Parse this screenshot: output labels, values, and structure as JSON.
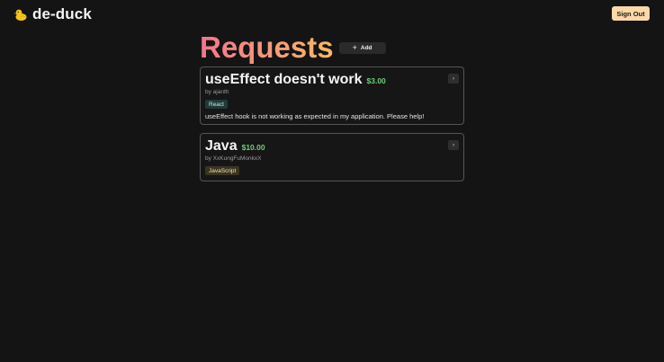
{
  "brand": {
    "name": "de-duck",
    "icon": "duck-icon"
  },
  "header": {
    "sign_out_label": "Sign Out"
  },
  "page": {
    "title": "Requests",
    "add_label": "Add"
  },
  "requests": [
    {
      "title": "useEffect doesn't work",
      "price": "$3.00",
      "author": "by ajanth",
      "tag": "React",
      "description": "useEffect hook is not working as expected in my application. Please help!"
    },
    {
      "title": "Java",
      "price": "$10.00",
      "author": "by XxKungFuMonkxX",
      "tag": "JavaScript",
      "description": ""
    }
  ],
  "colors": {
    "background": "#141414",
    "accent_button": "#fcd9a7",
    "price": "#6ad07a",
    "title_gradient_start": "#f2758c",
    "title_gradient_end": "#f8b866"
  }
}
